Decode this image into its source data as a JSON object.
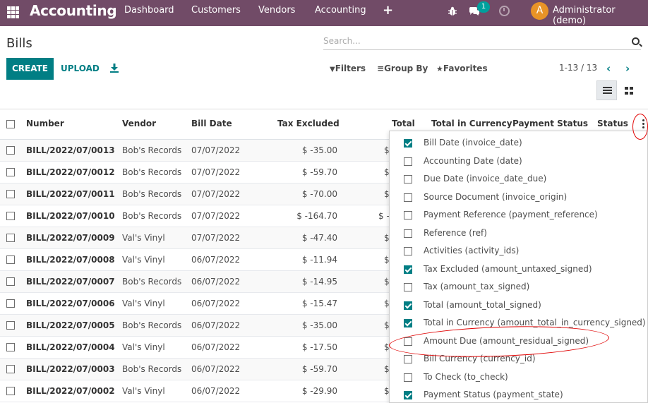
{
  "navbar": {
    "brand": "Accounting",
    "menu": [
      "Dashboard",
      "Customers",
      "Vendors",
      "Accounting"
    ],
    "plus": "+",
    "chat_count": "1",
    "avatar_letter": "A",
    "user": "Administrator (demo)",
    "color": "#714b67"
  },
  "control": {
    "title": "Bills",
    "search_placeholder": "Search...",
    "create_label": "CREATE",
    "upload_label": "UPLOAD",
    "filters_label": "Filters",
    "groupby_label": "Group By",
    "favorites_label": "Favorites",
    "pager": "1-13 / 13",
    "pager_prev": "‹",
    "pager_next": "›",
    "accent": "#017e84"
  },
  "table": {
    "headers": {
      "number": "Number",
      "vendor": "Vendor",
      "bill_date": "Bill Date",
      "tax_excluded": "Tax Excluded",
      "total": "Total",
      "total_currency": "Total in Currency",
      "payment_status": "Payment Status",
      "status": "Status"
    },
    "rows": [
      {
        "number": "BILL/2022/07/0013",
        "vendor": "Bob's Records",
        "date": "07/07/2022",
        "tax_excl": "$ -35.00",
        "total": "$"
      },
      {
        "number": "BILL/2022/07/0012",
        "vendor": "Bob's Records",
        "date": "07/07/2022",
        "tax_excl": "$ -59.70",
        "total": "$"
      },
      {
        "number": "BILL/2022/07/0011",
        "vendor": "Bob's Records",
        "date": "07/07/2022",
        "tax_excl": "$ -70.00",
        "total": "$"
      },
      {
        "number": "BILL/2022/07/0010",
        "vendor": "Bob's Records",
        "date": "07/07/2022",
        "tax_excl": "$ -164.70",
        "total": "$ -"
      },
      {
        "number": "BILL/2022/07/0009",
        "vendor": "Val's Vinyl",
        "date": "07/07/2022",
        "tax_excl": "$ -47.40",
        "total": "$"
      },
      {
        "number": "BILL/2022/07/0008",
        "vendor": "Val's Vinyl",
        "date": "06/07/2022",
        "tax_excl": "$ -11.94",
        "total": "$"
      },
      {
        "number": "BILL/2022/07/0007",
        "vendor": "Bob's Records",
        "date": "06/07/2022",
        "tax_excl": "$ -14.95",
        "total": "$"
      },
      {
        "number": "BILL/2022/07/0006",
        "vendor": "Val's Vinyl",
        "date": "06/07/2022",
        "tax_excl": "$ -15.47",
        "total": "$"
      },
      {
        "number": "BILL/2022/07/0005",
        "vendor": "Bob's Records",
        "date": "06/07/2022",
        "tax_excl": "$ -35.00",
        "total": "$"
      },
      {
        "number": "BILL/2022/07/0004",
        "vendor": "Val's Vinyl",
        "date": "06/07/2022",
        "tax_excl": "$ -17.50",
        "total": "$"
      },
      {
        "number": "BILL/2022/07/0003",
        "vendor": "Bob's Records",
        "date": "06/07/2022",
        "tax_excl": "$ -59.70",
        "total": "$"
      },
      {
        "number": "BILL/2022/07/0002",
        "vendor": "Val's Vinyl",
        "date": "06/07/2022",
        "tax_excl": "$ -29.90",
        "total": "$"
      }
    ]
  },
  "optional_columns": [
    {
      "label": "Bill Date (invoice_date)",
      "checked": true
    },
    {
      "label": "Accounting Date (date)",
      "checked": false
    },
    {
      "label": "Due Date (invoice_date_due)",
      "checked": false
    },
    {
      "label": "Source Document (invoice_origin)",
      "checked": false
    },
    {
      "label": "Payment Reference (payment_reference)",
      "checked": false
    },
    {
      "label": "Reference (ref)",
      "checked": false
    },
    {
      "label": "Activities (activity_ids)",
      "checked": false
    },
    {
      "label": "Tax Excluded (amount_untaxed_signed)",
      "checked": true
    },
    {
      "label": "Tax (amount_tax_signed)",
      "checked": false
    },
    {
      "label": "Total (amount_total_signed)",
      "checked": true
    },
    {
      "label": "Total in Currency (amount_total_in_currency_signed)",
      "checked": true
    },
    {
      "label": "Amount Due (amount_residual_signed)",
      "checked": false
    },
    {
      "label": "Bill Currency (currency_id)",
      "checked": false
    },
    {
      "label": "To Check (to_check)",
      "checked": false
    },
    {
      "label": "Payment Status (payment_state)",
      "checked": true
    }
  ]
}
